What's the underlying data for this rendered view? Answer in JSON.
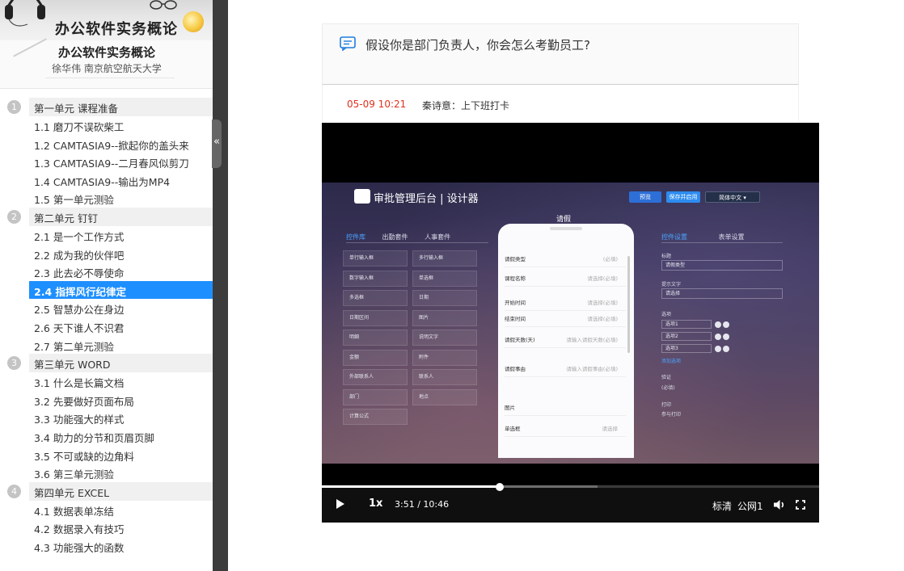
{
  "course": {
    "banner_title": "办公软件实务概论",
    "title": "办公软件实务概论",
    "teacher": "徐华伟 南京航空航天大学"
  },
  "sidebar": {
    "collapse_glyph": "«",
    "toc": [
      {
        "type": "unit",
        "num": "1",
        "label": "第一单元  课程准备"
      },
      {
        "type": "lesson",
        "label": "1.1  磨刀不误砍柴工"
      },
      {
        "type": "lesson",
        "label": "1.2  CAMTASIA9--掀起你的盖头来"
      },
      {
        "type": "lesson",
        "label": "1.3  CAMTASIA9--二月春风似剪刀"
      },
      {
        "type": "lesson",
        "label": "1.4  CAMTASIA9--输出为MP4"
      },
      {
        "type": "lesson",
        "label": "1.5  第一单元测验"
      },
      {
        "type": "unit",
        "num": "2",
        "label": "第二单元 钉钉"
      },
      {
        "type": "lesson",
        "label": "2.1  是一个工作方式"
      },
      {
        "type": "lesson",
        "label": "2.2  成为我的伙伴吧"
      },
      {
        "type": "lesson",
        "label": "2.3  此去必不辱使命"
      },
      {
        "type": "lesson",
        "label": "2.4  指挥风行纪律定",
        "active": true
      },
      {
        "type": "lesson",
        "label": "2.5  智慧办公在身边"
      },
      {
        "type": "lesson",
        "label": "2.6  天下谁人不识君"
      },
      {
        "type": "lesson",
        "label": "2.7  第二单元测验"
      },
      {
        "type": "unit",
        "num": "3",
        "label": "第三单元 WORD"
      },
      {
        "type": "lesson",
        "label": "3.1  什么是长篇文档"
      },
      {
        "type": "lesson",
        "label": "3.2  先要做好页面布局"
      },
      {
        "type": "lesson",
        "label": "3.3  功能强大的样式"
      },
      {
        "type": "lesson",
        "label": "3.4  助力的分节和页眉页脚"
      },
      {
        "type": "lesson",
        "label": "3.5  不可或缺的边角料"
      },
      {
        "type": "lesson",
        "label": "3.6  第三单元测验"
      },
      {
        "type": "unit",
        "num": "4",
        "label": "第四单元 EXCEL"
      },
      {
        "type": "lesson",
        "label": "4.1  数据表单冻结"
      },
      {
        "type": "lesson",
        "label": "4.2  数据录入有技巧"
      },
      {
        "type": "lesson",
        "label": "4.3  功能强大的函数"
      }
    ]
  },
  "question": {
    "text": "假设你是部门负责人，你会怎么考勤员工?",
    "reply_time": "05-09 10:21",
    "reply_author": "秦诗意：上下班打卡"
  },
  "video": {
    "app_title": "审批管理后台 | 设计器",
    "btn_preview": "预览",
    "btn_save": "保存并启用",
    "btn_lang": "简体中文",
    "form_title": "请假",
    "left_tabs": [
      "控件库",
      "出勤套件",
      "人事套件"
    ],
    "right_tabs": [
      "控件设置",
      "表单设置"
    ],
    "controls": [
      "单行输入框",
      "多行输入框",
      "数字输入框",
      "单选框",
      "多选框",
      "日期",
      "日期区间",
      "图片",
      "明细",
      "说明文字",
      "金额",
      "附件",
      "外部联系人",
      "联系人",
      "部门",
      "地点",
      "计算公式"
    ],
    "phone_fields": [
      {
        "label": "请假类型",
        "hint": "(必填)"
      },
      {
        "label": "课程名称",
        "hint": "请选择(必填)"
      },
      {
        "label": "开始时间",
        "hint": "请选择(必填)"
      },
      {
        "label": "结束时间",
        "hint": "请选择(必填)"
      },
      {
        "label": "请假天数(天)",
        "hint": "请输入请假天数(必填)"
      },
      {
        "label": "请假事由",
        "hint": "请输入请假事由(必填)"
      },
      {
        "label": "图片",
        "hint": ""
      },
      {
        "label": "单选框",
        "hint": "请选择"
      }
    ],
    "right_panel": {
      "title_label": "标题",
      "title_value": "请假类型",
      "prompt_label": "提示文字",
      "prompt_value": "请选择",
      "options_label": "选项",
      "options": [
        "选项1",
        "选项2",
        "选项3"
      ],
      "add_option": "添加选项",
      "required_label": "验证",
      "required_value": "(必填)",
      "print_label": "打印",
      "print_value": "参与打印"
    },
    "speed": "1x",
    "current_time": "3:51",
    "duration": "10:46",
    "progress_played": 0.358,
    "progress_buffered": 0.555,
    "quality": "标清",
    "line": "公网1",
    "volume_icon": "volume-icon",
    "fullscreen_icon": "fullscreen-icon"
  }
}
